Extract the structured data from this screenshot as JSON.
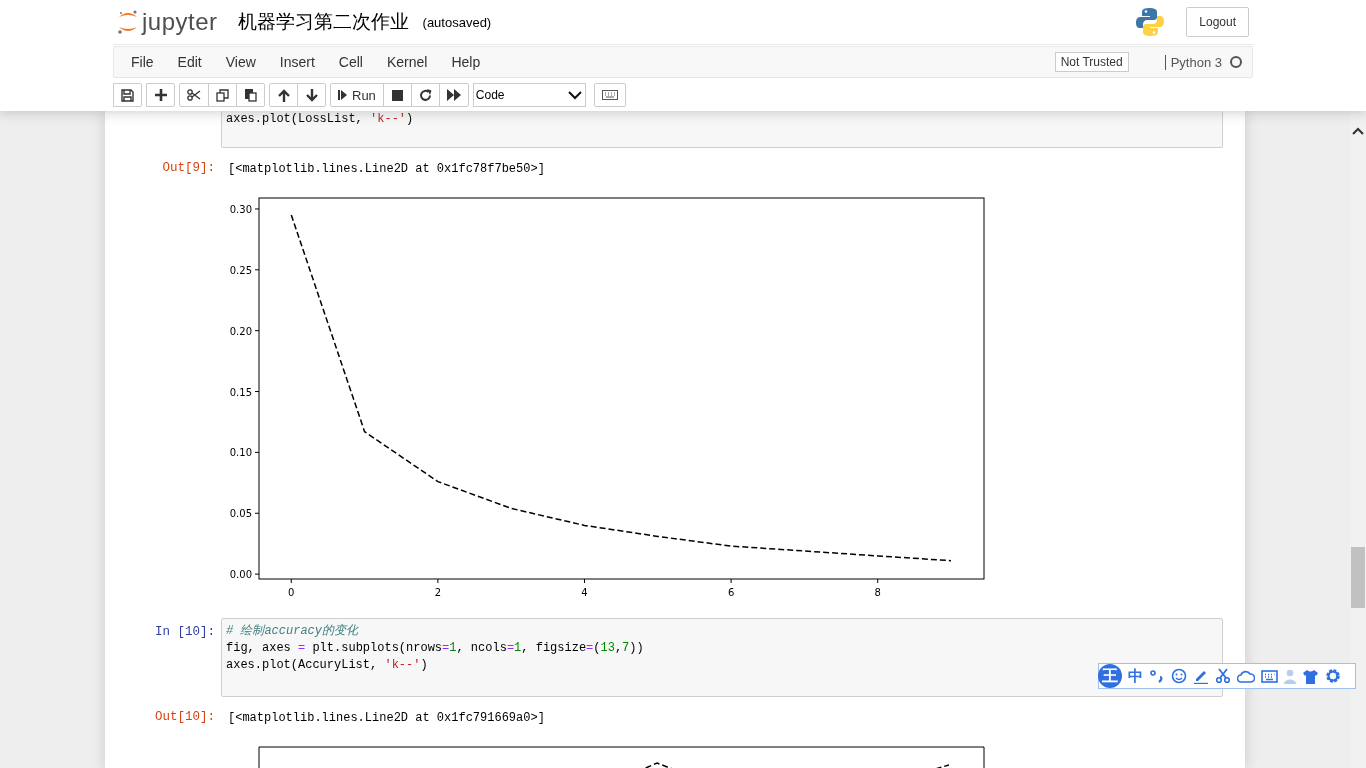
{
  "header": {
    "logo_text": "jupyter",
    "notebook_title": "机器学习第二次作业",
    "save_status": "(autosaved)",
    "logout": "Logout"
  },
  "menu": {
    "items": [
      "File",
      "Edit",
      "View",
      "Insert",
      "Cell",
      "Kernel",
      "Help"
    ],
    "trust": "Not Trusted",
    "kernel": {
      "name": "Python 3",
      "busy": false
    }
  },
  "toolbar": {
    "groups": [
      [
        {
          "kind": "save"
        }
      ],
      [
        {
          "kind": "add"
        }
      ],
      [
        {
          "kind": "cut"
        },
        {
          "kind": "copy"
        },
        {
          "kind": "paste"
        }
      ],
      [
        {
          "kind": "up"
        },
        {
          "kind": "down"
        }
      ],
      [
        {
          "kind": "run",
          "label": "Run"
        },
        {
          "kind": "stop"
        },
        {
          "kind": "restart"
        },
        {
          "kind": "fast_forward"
        }
      ]
    ],
    "cell_type": "Code"
  },
  "cells": [
    {
      "kind": "code_cut",
      "lines": [
        [
          {
            "t": "axes.plot(LossList, ",
            "kind": "plain"
          },
          {
            "t": "'k--'",
            "kind": "string"
          },
          {
            "t": ")",
            "kind": "plain"
          }
        ]
      ]
    },
    {
      "kind": "output",
      "prompt": "Out[9]:",
      "text": "[<matplotlib.lines.Line2D at 0x1fc78f7be50>]"
    },
    {
      "kind": "chart",
      "chart_data": {
        "type": "line",
        "x": [
          0,
          1,
          2,
          3,
          4,
          5,
          6,
          7,
          8,
          9
        ],
        "series": [
          {
            "color": "#000000",
            "line_style": "dashed",
            "values": [
              0.295,
              0.117,
              0.076,
              0.054,
              0.04,
              0.031,
              0.023,
              0.019,
              0.015,
              0.011
            ]
          }
        ],
        "xlim": [
          -0.44,
          9.45
        ],
        "ylim": [
          -0.004,
          0.309
        ],
        "xticks": [
          0,
          2,
          4,
          6,
          8
        ],
        "yticks": [
          {
            "value": 0,
            "label": "0.00"
          },
          {
            "value": 0.05,
            "label": "0.05"
          },
          {
            "value": 0.1,
            "label": "0.10"
          },
          {
            "value": 0.15,
            "label": "0.15"
          },
          {
            "value": 0.2,
            "label": "0.20"
          },
          {
            "value": 0.25,
            "label": "0.25"
          },
          {
            "value": 0.3,
            "label": "0.30"
          }
        ]
      }
    },
    {
      "kind": "code",
      "prompt": "In [10]:",
      "lines": [
        [
          {
            "t": "# 绘制accuracy的变化",
            "kind": "comment"
          }
        ],
        [
          {
            "t": "fig, axes ",
            "kind": "plain"
          },
          {
            "t": "=",
            "kind": "operator"
          },
          {
            "t": " plt.subplots(nrows",
            "kind": "plain"
          },
          {
            "t": "=",
            "kind": "operator"
          },
          {
            "t": "1",
            "kind": "number"
          },
          {
            "t": ", ncols",
            "kind": "plain"
          },
          {
            "t": "=",
            "kind": "operator"
          },
          {
            "t": "1",
            "kind": "number"
          },
          {
            "t": ", figsize",
            "kind": "plain"
          },
          {
            "t": "=",
            "kind": "operator"
          },
          {
            "t": "(",
            "kind": "plain"
          },
          {
            "t": "13",
            "kind": "number"
          },
          {
            "t": ",",
            "kind": "plain"
          },
          {
            "t": "7",
            "kind": "number"
          },
          {
            "t": "))",
            "kind": "plain"
          }
        ],
        [
          {
            "t": "axes.plot(AccuryList, ",
            "kind": "plain"
          },
          {
            "t": "'k--'",
            "kind": "string"
          },
          {
            "t": ")",
            "kind": "plain"
          }
        ]
      ]
    },
    {
      "kind": "output",
      "prompt": "Out[10]:",
      "text": "[<matplotlib.lines.Line2D at 0x1fc791669a0>]"
    },
    {
      "kind": "plot_cut"
    }
  ],
  "ime_toolbar": {
    "logo": "王",
    "mode": "中"
  }
}
